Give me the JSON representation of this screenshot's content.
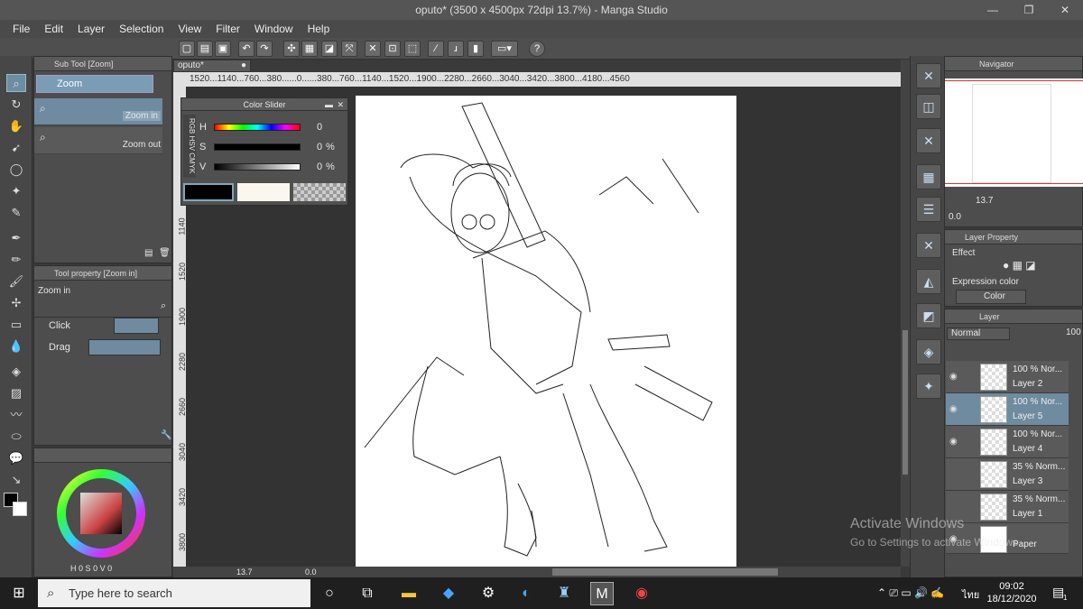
{
  "window": {
    "title": "oputo* (3500 x 4500px 72dpi 13.7%) - Manga Studio",
    "minimize": "—",
    "maximize": "❐",
    "close": "✕"
  },
  "menu": [
    "File",
    "Edit",
    "Layer",
    "Selection",
    "View",
    "Filter",
    "Window",
    "Help"
  ],
  "doc_tab": "oputo*",
  "sub_tool": {
    "title": "Sub Tool [Zoom]",
    "group": "Zoom",
    "items": [
      "Zoom in",
      "Zoom out"
    ]
  },
  "tool_property": {
    "title": "Tool property [Zoom in]",
    "heading": "Zoom in",
    "click_label": "Click",
    "drag_label": "Drag"
  },
  "color_slider": {
    "title": "Color Slider",
    "tabs": [
      "RGB",
      "HSV",
      "CMYK"
    ],
    "h_label": "H",
    "h_value": "0",
    "s_label": "S",
    "s_value": "0",
    "s_unit": "%",
    "v_label": "V",
    "v_value": "0",
    "v_unit": "%"
  },
  "color_wheel": {
    "h_label": "H",
    "h_value": "0",
    "s_label": "S",
    "s_value": "0",
    "v_label": "V",
    "v_value": "0"
  },
  "ruler_h": "1520...1140...760...380......0......380...760...1140...1520...1900...2280...2660...3040...3420...3800...4180...4560",
  "ruler_v": [
    "1140",
    "1520",
    "1900",
    "2280",
    "2660",
    "3040",
    "3420",
    "3800"
  ],
  "status_zoom": "13.7",
  "status_angle": "0.0",
  "navigator": {
    "title": "Navigator",
    "zoom": "13.7",
    "angle": "0.0"
  },
  "layer_property": {
    "title": "Layer Property",
    "effect_label": "Effect",
    "expression_label": "Expression color",
    "expression_value": "Color"
  },
  "layer_panel": {
    "title": "Layer",
    "blend_mode": "Normal",
    "opacity": "100"
  },
  "layers": [
    {
      "opacity": "100 %  Nor...",
      "name": "Layer 2",
      "visible": true,
      "selected": false
    },
    {
      "opacity": "100 %  Nor...",
      "name": "Layer 5",
      "visible": true,
      "selected": true
    },
    {
      "opacity": "100 %  Nor...",
      "name": "Layer 4",
      "visible": true,
      "selected": false
    },
    {
      "opacity": "35 %  Norm...",
      "name": "Layer 3",
      "visible": false,
      "selected": false
    },
    {
      "opacity": "35 %  Norm...",
      "name": "Layer 1",
      "visible": false,
      "selected": false
    },
    {
      "opacity": "",
      "name": "Paper",
      "visible": true,
      "selected": false
    }
  ],
  "watermark": {
    "line1": "Activate Windows",
    "line2": "Go to Settings to activate Windows."
  },
  "taskbar": {
    "search_placeholder": "Type here to search",
    "time": "09:02",
    "date": "18/12/2020",
    "language": "ไทย",
    "notification_count": "1"
  },
  "colors": {
    "accent": "#6b8da6",
    "navigator_frame": "#e03030"
  }
}
